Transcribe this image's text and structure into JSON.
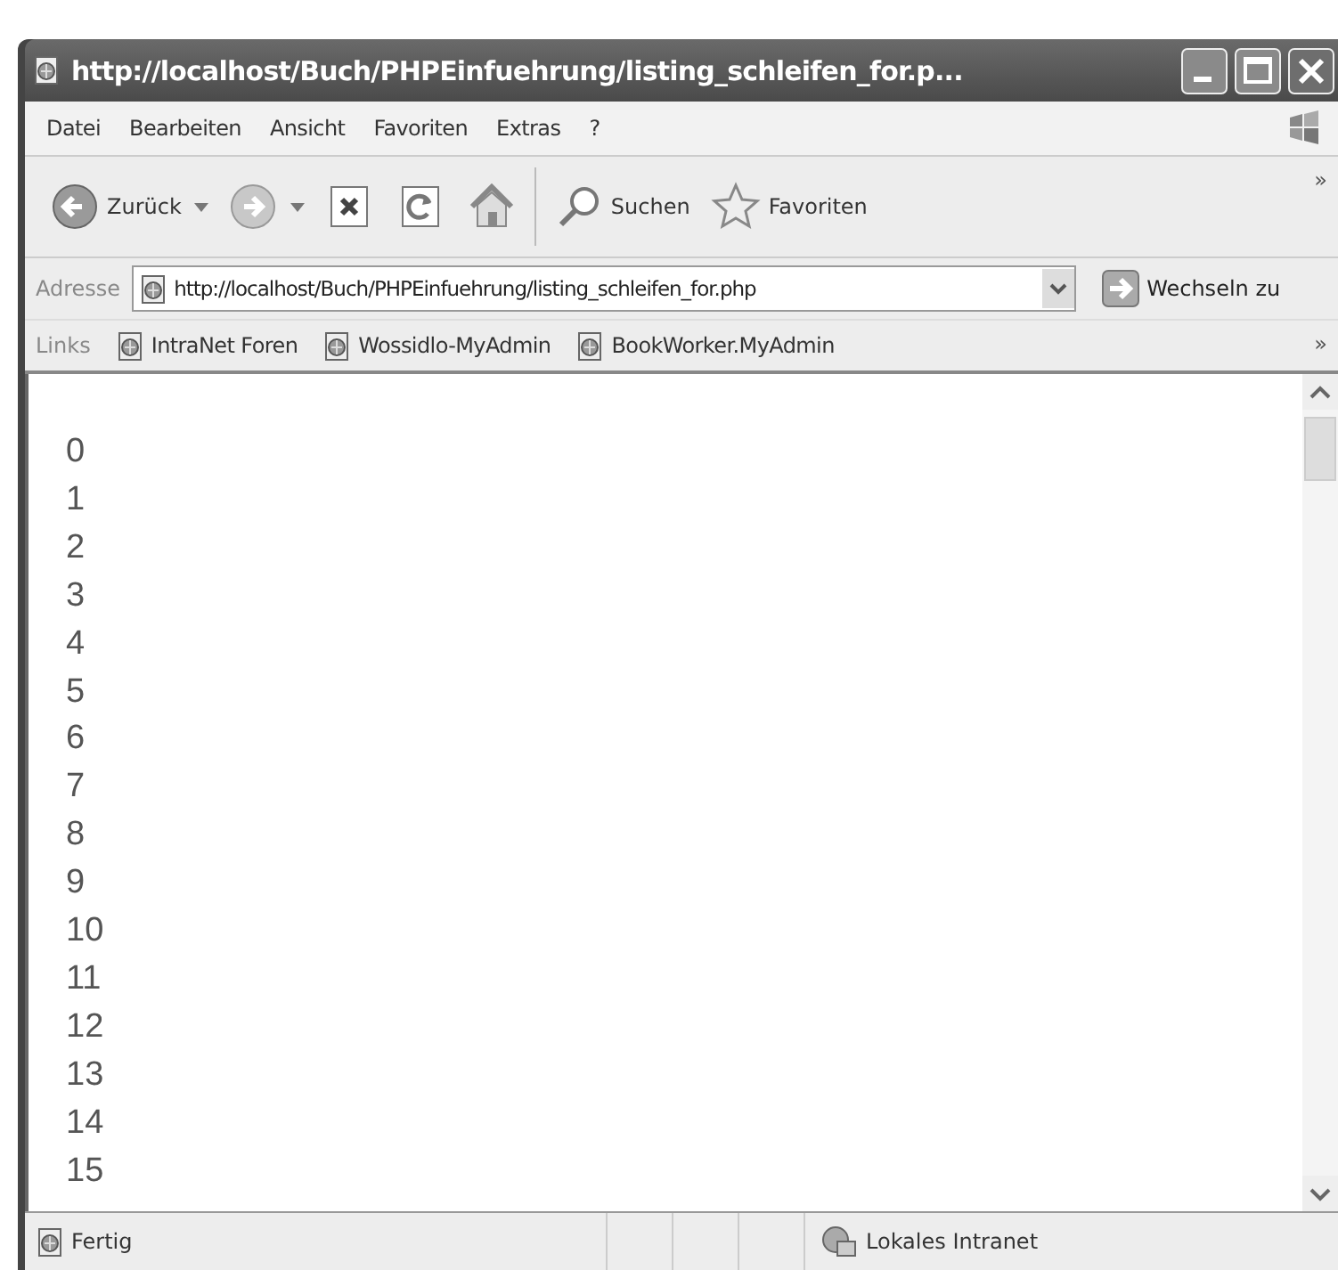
{
  "window": {
    "title": "http://localhost/Buch/PHPEinfuehrung/listing_schleifen_for.p..."
  },
  "menu": [
    "Datei",
    "Bearbeiten",
    "Ansicht",
    "Favoriten",
    "Extras",
    "?"
  ],
  "toolbar": {
    "buttons": [
      {
        "kind": "back",
        "label": "Zurück",
        "dropdown": true
      },
      {
        "kind": "forward",
        "dropdown": true
      },
      {
        "kind": "stop"
      },
      {
        "kind": "refresh"
      },
      {
        "kind": "home"
      },
      {
        "kind": "search",
        "label": "Suchen"
      },
      {
        "kind": "favorites",
        "label": "Favoriten"
      }
    ],
    "overflow": "»"
  },
  "address_bar": {
    "label": "Adresse",
    "value": "http://localhost/Buch/PHPEinfuehrung/listing_schleifen_for.php",
    "go_button": "Wechseln zu"
  },
  "links_bar": {
    "label": "Links",
    "items": [
      "IntraNet Foren",
      "Wossidlo-MyAdmin",
      "BookWorker.MyAdmin"
    ],
    "overflow": "»"
  },
  "content": {
    "lines": [
      "0",
      "1",
      "2",
      "3",
      "4",
      "5",
      "6",
      "7",
      "8",
      "9",
      "10",
      "11",
      "12",
      "13",
      "14",
      "15"
    ]
  },
  "status_bar": {
    "text": "Fertig",
    "zone": "Lokales Intranet"
  }
}
